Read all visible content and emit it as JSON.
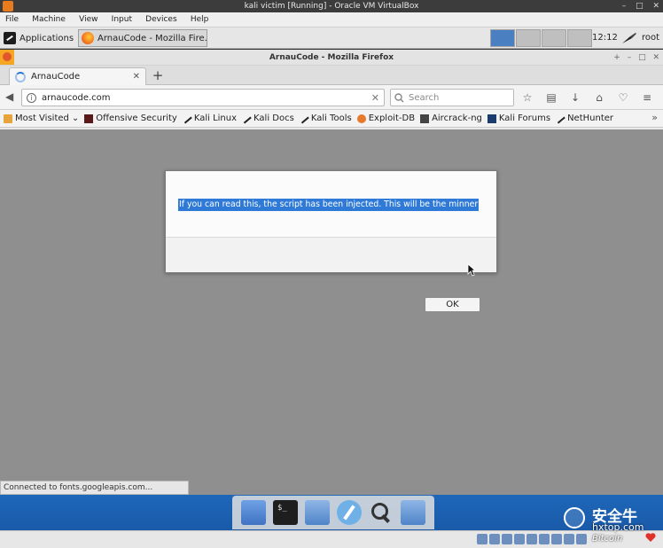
{
  "vbox": {
    "title": "kali victim [Running] - Oracle VM VirtualBox",
    "menu": [
      "File",
      "Machine",
      "View",
      "Input",
      "Devices",
      "Help"
    ],
    "window_controls": [
      "–",
      "□",
      "✕"
    ],
    "host_key": ""
  },
  "panel": {
    "applications_label": "Applications",
    "task_label": "ArnauCode - Mozilla Fire...",
    "clock": "12:12",
    "user": "root",
    "workspace_count": 4
  },
  "firefox": {
    "window_title": "ArnauCode - Mozilla Firefox",
    "tab_label": "ArnauCode",
    "tab_close": "✕",
    "new_tab": "+",
    "url": "arnaucode.com",
    "search_placeholder": "Search",
    "bookmarks_menu": "Most Visited",
    "bookmarks": [
      "Offensive Security",
      "Kali Linux",
      "Kali Docs",
      "Kali Tools",
      "Exploit-DB",
      "Aircrack-ng",
      "Kali Forums",
      "NetHunter"
    ],
    "toolbar_icons": [
      "star-icon",
      "library-icon",
      "download-icon",
      "home-icon",
      "pocket-icon",
      "menu-icon"
    ],
    "status_text": "Connected to fonts.googleapis.com..."
  },
  "dialog": {
    "message": "If you can read this, the script has been injected. This will be the minner",
    "ok_label": "OK"
  },
  "dock": {
    "apps": [
      "files-icon",
      "terminal-icon",
      "folder-icon",
      "compass-icon",
      "search-icon",
      "folder-icon"
    ]
  },
  "watermark": {
    "title": "安全牛",
    "site": "hxtop.com",
    "coin": "Bitcoin"
  },
  "colors": {
    "accent": "#2f7ad6",
    "dock_blue": "#1e67b9",
    "content_bg": "#8f8f8f"
  }
}
